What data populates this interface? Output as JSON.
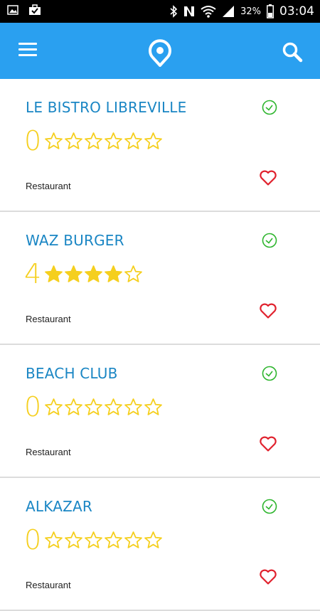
{
  "status_bar": {
    "battery": "32%",
    "time": "03:04"
  },
  "app_bar": {
    "menu_icon": "hamburger-menu-icon",
    "logo_icon": "location-pin-logo-icon",
    "search_icon": "search-icon",
    "color": "#2aa0f0"
  },
  "places": [
    {
      "name": "LE BISTRO LIBREVILLE",
      "rating": "0",
      "stars_filled": 0,
      "stars_total": 6,
      "category": "Restaurant"
    },
    {
      "name": "WAZ BURGER",
      "rating": "4",
      "stars_filled": 4,
      "stars_total": 5,
      "category": "Restaurant"
    },
    {
      "name": "BEACH CLUB",
      "rating": "0",
      "stars_filled": 0,
      "stars_total": 6,
      "category": "Restaurant"
    },
    {
      "name": "ALKAZAR",
      "rating": "0",
      "stars_filled": 0,
      "stars_total": 6,
      "category": "Restaurant"
    }
  ],
  "colors": {
    "title": "#1a86c4",
    "star": "#f5cf1e",
    "clock": "#2db52d",
    "heart": "#e0202c"
  }
}
